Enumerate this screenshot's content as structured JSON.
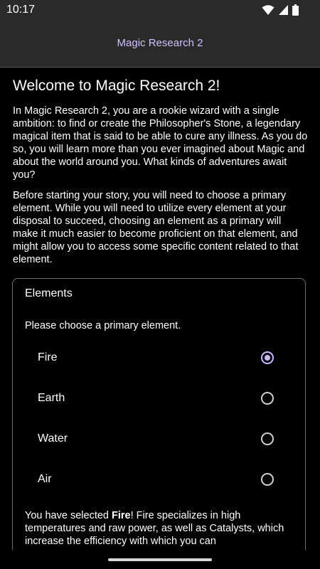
{
  "status": {
    "time": "10:17",
    "icons": [
      "wifi-icon",
      "signal-icon",
      "battery-icon"
    ]
  },
  "appbar": {
    "title": "Magic Research 2"
  },
  "welcome": {
    "title": "Welcome to Magic Research 2!",
    "paragraph1": "In Magic Research 2, you are a rookie wizard with a single ambition: to find or create the Philosopher's Stone, a legendary magical item that is said to be able to cure any illness. As you do so, you will learn more than you ever imagined about Magic and about the world around you. What kinds of adventures await you?",
    "paragraph2": "Before starting your story, you will need to choose a primary element. While you will need to utilize every element at your disposal to succeed, choosing an element as a primary will make it much easier to become proficient on that element, and might allow you to access some specific content related to that element."
  },
  "elements": {
    "title": "Elements",
    "prompt": "Please choose a primary element.",
    "options": [
      {
        "label": "Fire",
        "selected": true
      },
      {
        "label": "Earth",
        "selected": false
      },
      {
        "label": "Water",
        "selected": false
      },
      {
        "label": "Air",
        "selected": false
      }
    ],
    "selection_prefix": "You have selected ",
    "selection_name": "Fire",
    "selection_text": "! Fire specializes in high temperatures and raw power, as well as Catalysts, which increase the efficiency with which you can"
  },
  "colors": {
    "accent": "#c9b8ff",
    "bar_background": "#2a2a2a",
    "background": "#000000"
  }
}
